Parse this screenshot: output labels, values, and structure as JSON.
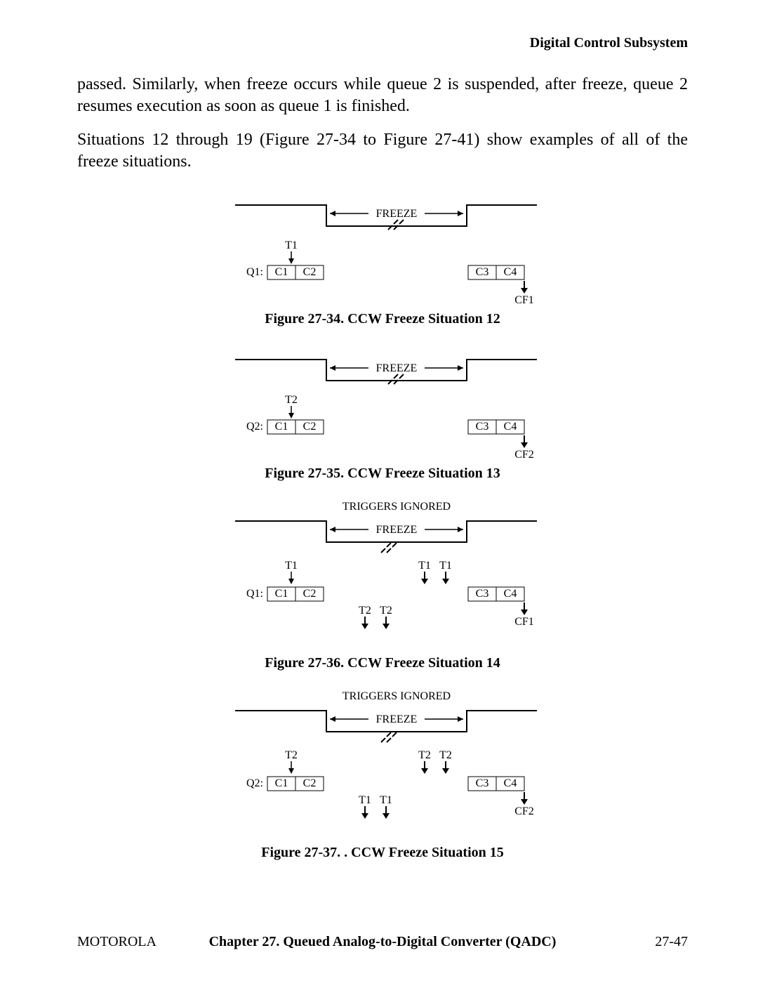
{
  "header": {
    "section_title": "Digital Control Subsystem"
  },
  "paragraphs": {
    "p1": "passed. Similarly, when freeze occurs while queue 2 is suspended, after freeze, queue 2 resumes execution as soon as queue 1 is finished.",
    "p2": "Situations 12 through 19 (Figure 27-34 to Figure 27-41) show examples of all of the freeze situations."
  },
  "labels": {
    "freeze": "FREEZE",
    "triggers_ignored": "TRIGGERS IGNORED",
    "T1": "T1",
    "T2": "T2",
    "Q1": "Q1:",
    "Q2": "Q2:",
    "C1": "C1",
    "C2": "C2",
    "C3": "C3",
    "C4": "C4",
    "CF1": "CF1",
    "CF2": "CF2"
  },
  "figures": {
    "f34": {
      "caption": "Figure 27-34. CCW Freeze Situation 12"
    },
    "f35": {
      "caption": "Figure 27-35. CCW Freeze Situation 13"
    },
    "f36": {
      "caption": "Figure 27-36. CCW Freeze Situation 14"
    },
    "f37": {
      "caption": "Figure 27-37. . CCW Freeze Situation 15"
    }
  },
  "footer": {
    "left": "MOTOROLA",
    "center": "Chapter 27.  Queued Analog-to-Digital Converter (QADC)",
    "right": "27-47"
  }
}
